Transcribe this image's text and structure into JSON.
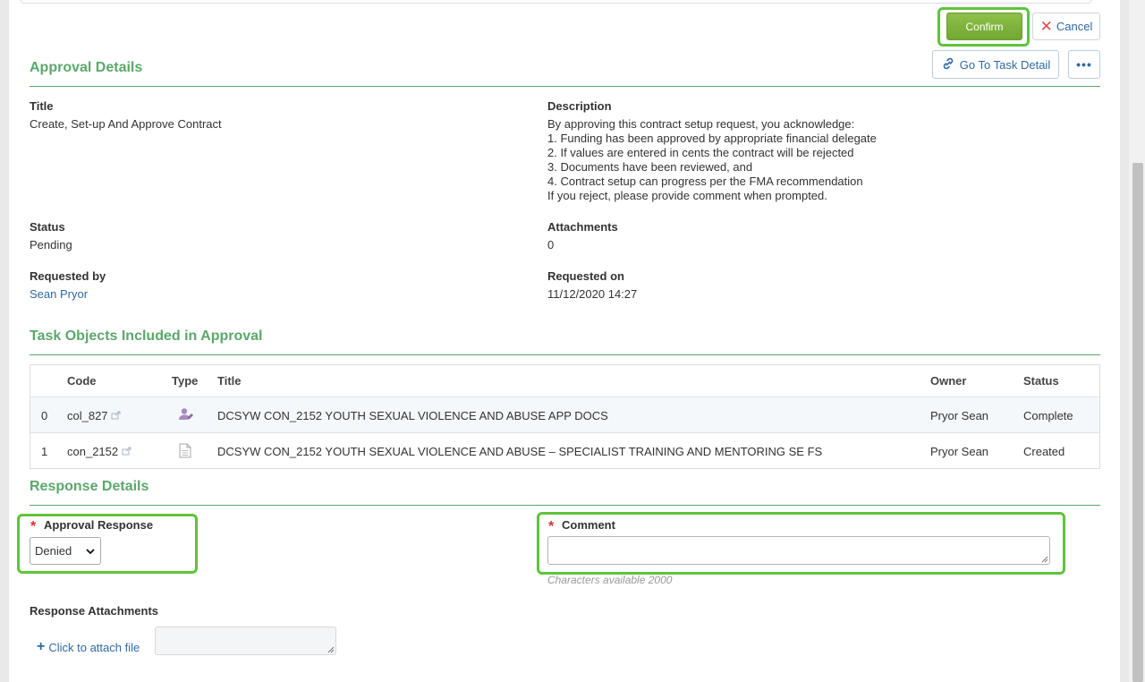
{
  "actions": {
    "confirm_label": "Confirm",
    "cancel_label": "Cancel",
    "go_to_task_label": "Go To Task Detail",
    "more_label": "•••"
  },
  "approval_details": {
    "heading": "Approval Details",
    "title_label": "Title",
    "title_value": "Create, Set-up And Approve Contract",
    "description_label": "Description",
    "description_lines": [
      "By approving this contract setup request, you acknowledge:",
      "1. Funding has been approved by appropriate financial delegate",
      "2. If values are entered in cents the contract will be rejected",
      "3. Documents have been reviewed, and",
      "4. Contract setup can progress per the FMA recommendation",
      "If you reject, please provide comment when prompted."
    ],
    "status_label": "Status",
    "status_value": "Pending",
    "attachments_label": "Attachments",
    "attachments_value": "0",
    "requested_by_label": "Requested by",
    "requested_by_value": "Sean Pryor",
    "requested_on_label": "Requested on",
    "requested_on_value": "11/12/2020 14:27"
  },
  "task_objects": {
    "heading": "Task Objects Included in Approval",
    "columns": [
      "Code",
      "Type",
      "Title",
      "Owner",
      "Status"
    ],
    "rows": [
      {
        "index": "0",
        "code": "col_827",
        "type_icon": "user-edit-icon",
        "title": "DCSYW CON_2152 YOUTH SEXUAL VIOLENCE AND ABUSE APP DOCS",
        "owner": "Pryor Sean",
        "status": "Complete"
      },
      {
        "index": "1",
        "code": "con_2152",
        "type_icon": "document-icon",
        "title": "DCSYW CON_2152 YOUTH SEXUAL VIOLENCE AND ABUSE – SPECIALIST TRAINING AND MENTORING SE FS",
        "owner": "Pryor Sean",
        "status": "Created"
      }
    ]
  },
  "response_details": {
    "heading": "Response Details",
    "approval_response_label": "Approval Response",
    "approval_response_value": "Denied",
    "comment_label": "Comment",
    "comment_value": "",
    "chars_hint": "Characters available 2000",
    "attachments_label": "Response Attachments",
    "attach_link": "Click to attach file"
  },
  "colors": {
    "accent_green": "#5aa86a",
    "confirm_green": "#7db03a",
    "link_blue": "#2f6aa3",
    "highlight": "#5ec43b",
    "required_red": "#e03030"
  }
}
